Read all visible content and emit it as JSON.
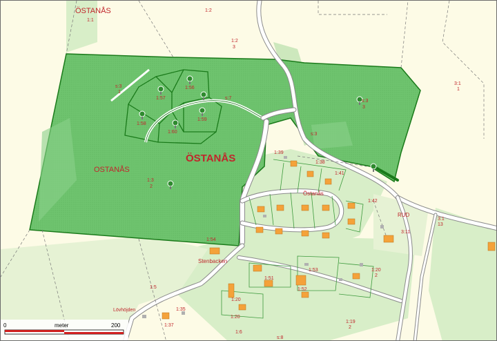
{
  "labels": {
    "ostanas_top": "ÖSTANÅS",
    "ostanas_center": "ÖSTANÅS",
    "ostanas_left": "OSTANÅS",
    "ostanas_street": "Östanås",
    "stenbacken": "Stenbacken",
    "lovhojden": "Lövhöjden",
    "rud": "RUD"
  },
  "parcels": {
    "p1_1": "1:1",
    "p1_2": "1:2",
    "p1_2b": "1:2",
    "p1_2b_sub": "3",
    "s3a": "s:3",
    "s3a_sub": "1",
    "p1_56": "1:56",
    "p1_57": "1:57",
    "p1_58": "1:58",
    "p1_59": "1:59",
    "p1_60": "1:60",
    "s7": "s:7",
    "s3b": "s:3",
    "s3b_sub": "3",
    "s3c": "s:3",
    "p3_1": "3:1",
    "p3_1_sub": "1",
    "p1_3": "1:3",
    "p1_3_sub": "2",
    "p1_39": "1:39",
    "p1_38": "1:38",
    "p1_41": "1:41",
    "p1_42": "1:42",
    "p1_54": "1:54",
    "p1_53": "1:53",
    "p1_51": "1:51",
    "p1_52": "1:52",
    "p1_20a": "1:20",
    "p1_20a_sub": "2",
    "p1_20b": "1:20",
    "p1_20c": "1:20",
    "p1_5": "1:5",
    "p1_35": "1:35",
    "p1_37": "1:37",
    "p1_6": "1:6",
    "p1_19": "1:19",
    "p1_19_sub": "2",
    "p3_11": "3:11",
    "p3_1b": "3:1",
    "p3_1b_sub": "13",
    "s8": "s:8"
  },
  "scalebar": {
    "start": "0",
    "unit": "meter",
    "end": "200"
  },
  "colors": {
    "background": "#fdfbe6",
    "forest": "#6fc46f",
    "forest_border": "#1a7a1a",
    "light_green": "#d4ecc4",
    "road": "#ffffff",
    "road_edge": "#8a8a8a",
    "house": "#f4a23a",
    "label": "#c0262b"
  }
}
